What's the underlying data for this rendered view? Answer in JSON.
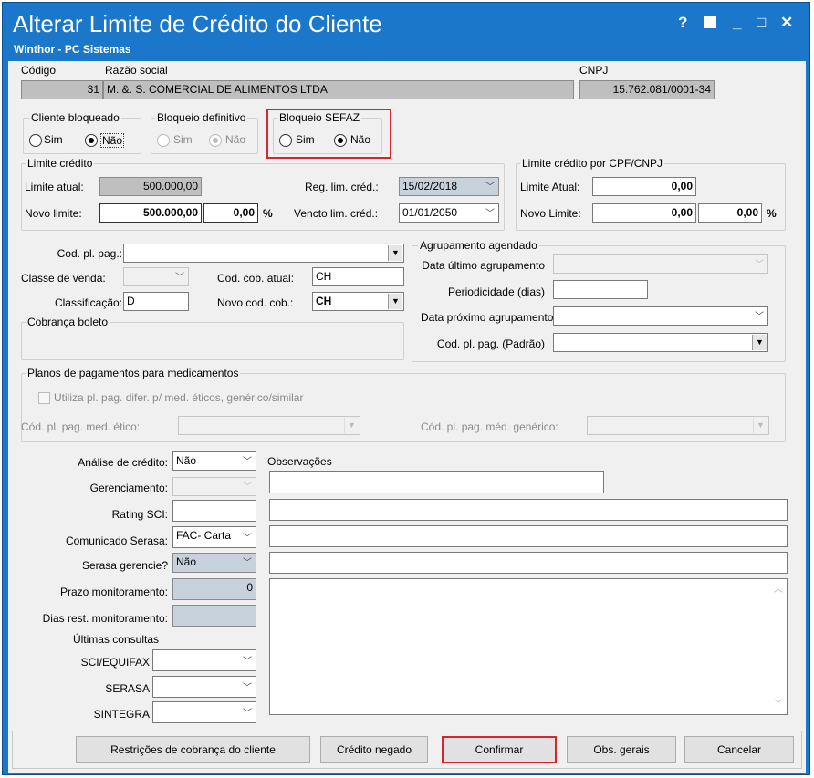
{
  "window": {
    "title": "Alterar Limite de Crédito do Cliente",
    "subtitle": "Winthor - PC Sistemas",
    "help": "?",
    "restore": "▪",
    "minimize": "_",
    "maximize": "□",
    "close": "✕"
  },
  "header": {
    "codigo_label": "Código",
    "codigo_value": "31",
    "razao_label": "Razão social",
    "razao_value": "M. &. S. COMERCIAL DE ALIMENTOS LTDA",
    "cnpj_label": "CNPJ",
    "cnpj_value": "15.762.081/0001-34"
  },
  "bloqueio": {
    "cliente_title": "Cliente bloqueado",
    "definitivo_title": "Bloqueio definitivo",
    "sefaz_title": "Bloqueio SEFAZ",
    "sim": "Sim",
    "nao": "Não"
  },
  "limite": {
    "title": "Limite crédito",
    "atual_label": "Limite atual:",
    "atual_value": "500.000,00",
    "novo_label": "Novo limite:",
    "novo_value": "500.000,00",
    "novo_pct": "0,00",
    "pct": "%",
    "reg_label": "Reg. lim. créd.:",
    "reg_value": "15/02/2018",
    "vencto_label": "Vencto lim. créd.:",
    "vencto_value": "01/01/2050"
  },
  "limite_cpf": {
    "title": "Limite crédito por CPF/CNPJ",
    "atual_label": "Limite Atual:",
    "atual_value": "0,00",
    "novo_label": "Novo Limite:",
    "novo_value": "0,00",
    "novo_pct": "0,00",
    "pct": "%"
  },
  "cobranca": {
    "cod_pl_pag_label": "Cod. pl. pag.:",
    "cod_pl_pag_value": "",
    "classe_label": "Classe de venda:",
    "classe_value": "",
    "cod_cob_atual_label": "Cod. cob. atual:",
    "cod_cob_atual_value": "CH",
    "classificacao_label": "Classificação:",
    "classificacao_value": "D",
    "novo_cod_cob_label": "Novo cod. cob.:",
    "novo_cod_cob_value": "CH",
    "boleto_title": "Cobrança boleto"
  },
  "agrupamento": {
    "title": "Agrupamento agendado",
    "ultimo_label": "Data último agrupamento",
    "periodicidade_label": "Periodicidade (dias)",
    "proximo_label": "Data próximo agrupamento",
    "cod_pl_label": "Cod. pl. pag. (Padrão)"
  },
  "medicamentos": {
    "title": "Planos de pagamentos para medicamentos",
    "utiliza_label": "Utiliza pl. pag. difer. p/ med. éticos, genérico/similar",
    "etico_label": "Cód. pl. pag. med. ético:",
    "generico_label": "Cód. pl. pag. méd. genérico:"
  },
  "analise": {
    "analise_label": "Análise de crédito:",
    "analise_value": "Não",
    "gerenciamento_label": "Gerenciamento:",
    "rating_label": "Rating SCI:",
    "comunicado_label": "Comunicado Serasa:",
    "comunicado_value": "FAC- Carta",
    "serasa_ger_label": "Serasa gerencie?",
    "serasa_ger_value": "Não",
    "prazo_label": "Prazo monitoramento:",
    "prazo_value": "0",
    "dias_label": "Dias rest. monitoramento:",
    "ultimas_label": "Últimas consultas",
    "sci_label": "SCI/EQUIFAX",
    "serasa_label": "SERASA",
    "sintegra_label": "SINTEGRA",
    "obs_label": "Observações"
  },
  "buttons": {
    "restricoes": "Restrições de cobrança do cliente",
    "credito_negado": "Crédito negado",
    "confirmar": "Confirmar",
    "obs_gerais": "Obs. gerais",
    "cancelar": "Cancelar"
  },
  "colors": {
    "titlebar": "#1a77c9",
    "highlight": "#d6262c"
  }
}
